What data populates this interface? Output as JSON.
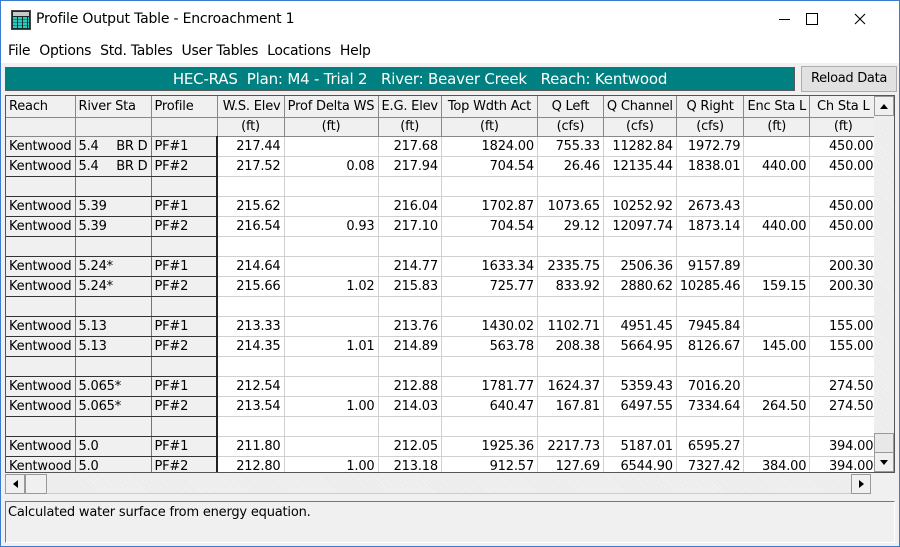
{
  "window": {
    "title": "Profile Output Table - Encroachment 1",
    "app_icon": "table-grid-icon",
    "controls": [
      "minimize",
      "maximize",
      "close"
    ]
  },
  "menu": [
    "File",
    "Options",
    "Std. Tables",
    "User Tables",
    "Locations",
    "Help"
  ],
  "banner": {
    "text": "HEC-RAS  Plan: M4 - Trial 2   River: Beaver Creek   Reach: Kentwood",
    "color": "#008080"
  },
  "reload_button": "Reload Data",
  "table": {
    "columns": [
      {
        "label": "Reach",
        "unit": ""
      },
      {
        "label": "River Sta",
        "unit": ""
      },
      {
        "label": "Profile",
        "unit": ""
      },
      {
        "label": "W.S. Elev",
        "unit": "(ft)"
      },
      {
        "label": "Prof Delta WS",
        "unit": "(ft)"
      },
      {
        "label": "E.G. Elev",
        "unit": "(ft)"
      },
      {
        "label": "Top Wdth Act",
        "unit": "(ft)"
      },
      {
        "label": "Q Left",
        "unit": "(cfs)"
      },
      {
        "label": "Q Channel",
        "unit": "(cfs)"
      },
      {
        "label": "Q Right",
        "unit": "(cfs)"
      },
      {
        "label": "Enc Sta L",
        "unit": "(ft)"
      },
      {
        "label": "Ch Sta L",
        "unit": "(ft)"
      }
    ],
    "rows": [
      {
        "reach": "Kentwood",
        "sta": "5.4",
        "sta_tag": "BR D",
        "profile": "PF#1",
        "ws_elev": "217.44",
        "delta_ws": "",
        "eg_elev": "217.68",
        "top_wdth": "1824.00",
        "q_left": "755.33",
        "q_channel": "11282.84",
        "q_right": "1972.79",
        "enc_sta_l": "",
        "ch_sta_l": "450.00"
      },
      {
        "reach": "Kentwood",
        "sta": "5.4",
        "sta_tag": "BR D",
        "profile": "PF#2",
        "ws_elev": "217.52",
        "delta_ws": "0.08",
        "eg_elev": "217.94",
        "top_wdth": "704.54",
        "q_left": "26.46",
        "q_channel": "12135.44",
        "q_right": "1838.01",
        "enc_sta_l": "440.00",
        "ch_sta_l": "450.00"
      },
      {
        "blank": true
      },
      {
        "reach": "Kentwood",
        "sta": "5.39",
        "sta_tag": "",
        "profile": "PF#1",
        "ws_elev": "215.62",
        "delta_ws": "",
        "eg_elev": "216.04",
        "top_wdth": "1702.87",
        "q_left": "1073.65",
        "q_channel": "10252.92",
        "q_right": "2673.43",
        "enc_sta_l": "",
        "ch_sta_l": "450.00"
      },
      {
        "reach": "Kentwood",
        "sta": "5.39",
        "sta_tag": "",
        "profile": "PF#2",
        "ws_elev": "216.54",
        "delta_ws": "0.93",
        "eg_elev": "217.10",
        "top_wdth": "704.54",
        "q_left": "29.12",
        "q_channel": "12097.74",
        "q_right": "1873.14",
        "enc_sta_l": "440.00",
        "ch_sta_l": "450.00"
      },
      {
        "blank": true
      },
      {
        "reach": "Kentwood",
        "sta": "5.24*",
        "sta_tag": "",
        "profile": "PF#1",
        "ws_elev": "214.64",
        "delta_ws": "",
        "eg_elev": "214.77",
        "top_wdth": "1633.34",
        "q_left": "2335.75",
        "q_channel": "2506.36",
        "q_right": "9157.89",
        "enc_sta_l": "",
        "ch_sta_l": "200.30"
      },
      {
        "reach": "Kentwood",
        "sta": "5.24*",
        "sta_tag": "",
        "profile": "PF#2",
        "ws_elev": "215.66",
        "delta_ws": "1.02",
        "eg_elev": "215.83",
        "top_wdth": "725.77",
        "q_left": "833.92",
        "q_channel": "2880.62",
        "q_right": "10285.46",
        "enc_sta_l": "159.15",
        "ch_sta_l": "200.30"
      },
      {
        "blank": true
      },
      {
        "reach": "Kentwood",
        "sta": "5.13",
        "sta_tag": "",
        "profile": "PF#1",
        "ws_elev": "213.33",
        "delta_ws": "",
        "eg_elev": "213.76",
        "top_wdth": "1430.02",
        "q_left": "1102.71",
        "q_channel": "4951.45",
        "q_right": "7945.84",
        "enc_sta_l": "",
        "ch_sta_l": "155.00"
      },
      {
        "reach": "Kentwood",
        "sta": "5.13",
        "sta_tag": "",
        "profile": "PF#2",
        "ws_elev": "214.35",
        "delta_ws": "1.01",
        "eg_elev": "214.89",
        "top_wdth": "563.78",
        "q_left": "208.38",
        "q_channel": "5664.95",
        "q_right": "8126.67",
        "enc_sta_l": "145.00",
        "ch_sta_l": "155.00"
      },
      {
        "blank": true
      },
      {
        "reach": "Kentwood",
        "sta": "5.065*",
        "sta_tag": "",
        "profile": "PF#1",
        "ws_elev": "212.54",
        "delta_ws": "",
        "eg_elev": "212.88",
        "top_wdth": "1781.77",
        "q_left": "1624.37",
        "q_channel": "5359.43",
        "q_right": "7016.20",
        "enc_sta_l": "",
        "ch_sta_l": "274.50"
      },
      {
        "reach": "Kentwood",
        "sta": "5.065*",
        "sta_tag": "",
        "profile": "PF#2",
        "ws_elev": "213.54",
        "delta_ws": "1.00",
        "eg_elev": "214.03",
        "top_wdth": "640.47",
        "q_left": "167.81",
        "q_channel": "6497.55",
        "q_right": "7334.64",
        "enc_sta_l": "264.50",
        "ch_sta_l": "274.50"
      },
      {
        "blank": true
      },
      {
        "reach": "Kentwood",
        "sta": "5.0",
        "sta_tag": "",
        "profile": "PF#1",
        "ws_elev": "211.80",
        "delta_ws": "",
        "eg_elev": "212.05",
        "top_wdth": "1925.36",
        "q_left": "2217.73",
        "q_channel": "5187.01",
        "q_right": "6595.27",
        "enc_sta_l": "",
        "ch_sta_l": "394.00"
      },
      {
        "reach": "Kentwood",
        "sta": "5.0",
        "sta_tag": "",
        "profile": "PF#2",
        "ws_elev": "212.80",
        "delta_ws": "1.00",
        "eg_elev": "213.18",
        "top_wdth": "912.57",
        "q_left": "127.69",
        "q_channel": "6544.90",
        "q_right": "7327.42",
        "enc_sta_l": "384.00",
        "ch_sta_l": "394.00"
      }
    ]
  },
  "status": "Calculated water surface from energy equation."
}
